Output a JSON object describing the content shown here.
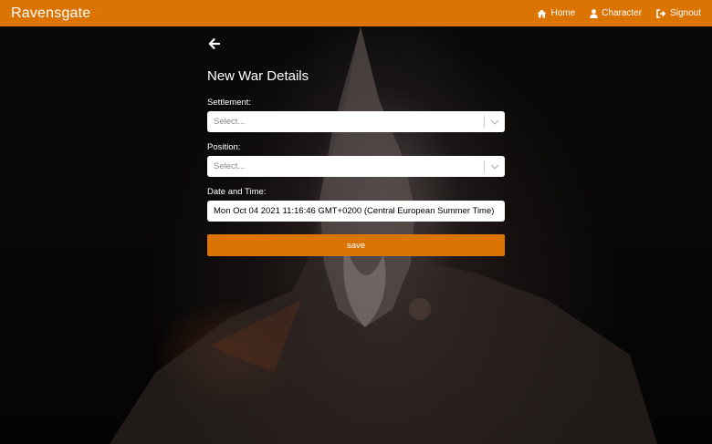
{
  "navbar": {
    "brand": "Ravensgate",
    "links": [
      {
        "label": "Home",
        "icon": "home-icon"
      },
      {
        "label": "Character",
        "icon": "user-icon"
      },
      {
        "label": "Signout",
        "icon": "signout-icon"
      }
    ],
    "color": "#dc7404"
  },
  "form": {
    "title": "New War Details",
    "settlement": {
      "label": "Settlement:",
      "placeholder": "Select..."
    },
    "position": {
      "label": "Position:",
      "placeholder": "Select..."
    },
    "datetime": {
      "label": "Date and Time:",
      "value": "Mon Oct 04 2021 11:16:46 GMT+0200 (Central European Summer Time)"
    },
    "save_label": "save",
    "back_icon": "arrow-left-icon"
  }
}
